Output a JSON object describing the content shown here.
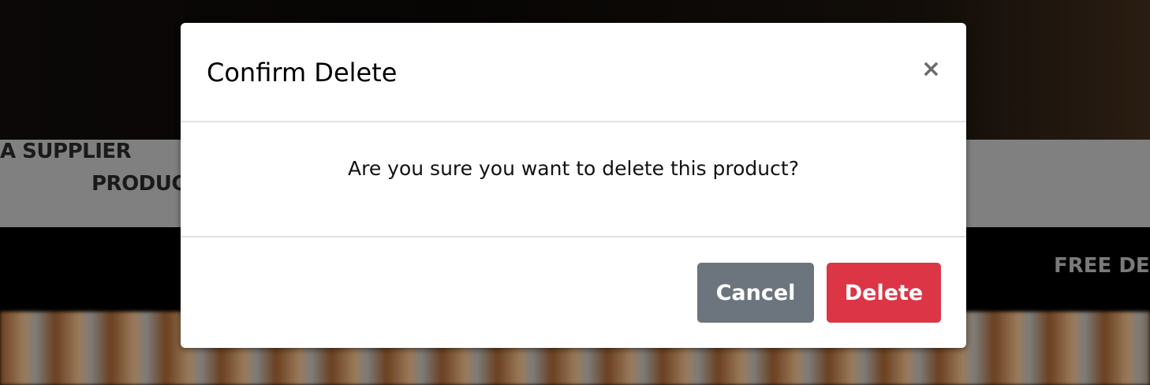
{
  "background": {
    "nav_left": "PRODUC",
    "nav_right": "A SUPPLIER",
    "promo": "FREE DE"
  },
  "modal": {
    "title": "Confirm Delete",
    "close": "×",
    "message": "Are you sure you want to delete this product?",
    "cancel_label": "Cancel",
    "delete_label": "Delete"
  },
  "colors": {
    "cancel": "#6c757d",
    "delete": "#dc3545"
  }
}
